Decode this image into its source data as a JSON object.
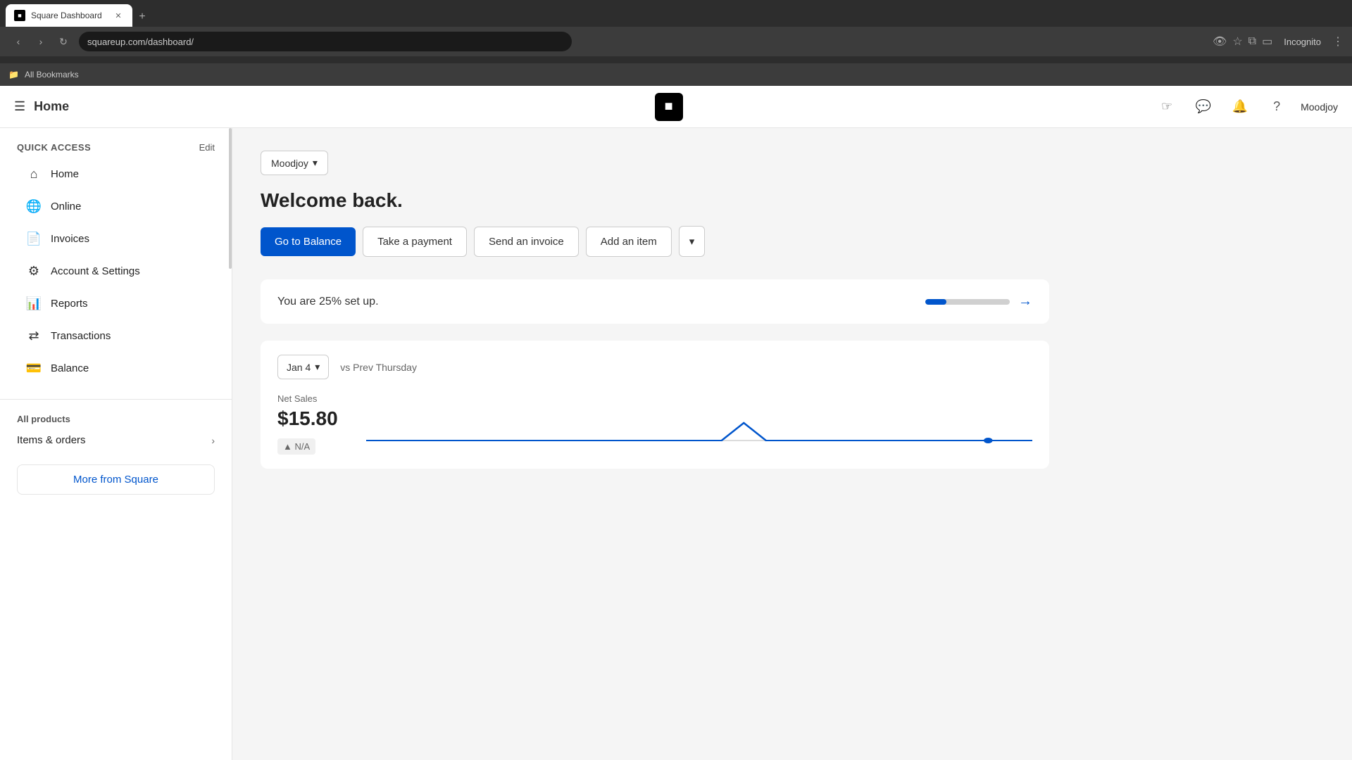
{
  "browser": {
    "url": "squareup.com/dashboard/",
    "tab_title": "Square Dashboard",
    "tab_new_label": "+",
    "bookmarks_label": "All Bookmarks",
    "profile_label": "Incognito"
  },
  "topbar": {
    "menu_icon": "☰",
    "title": "Home",
    "user_name": "Moodjoy"
  },
  "sidebar": {
    "quick_access_label": "Quick access",
    "edit_label": "Edit",
    "nav_items": [
      {
        "icon": "⌂",
        "label": "Home"
      },
      {
        "icon": "🌐",
        "label": "Online"
      },
      {
        "icon": "📄",
        "label": "Invoices"
      },
      {
        "icon": "⚙",
        "label": "Account & Settings"
      },
      {
        "icon": "📊",
        "label": "Reports"
      },
      {
        "icon": "⇄",
        "label": "Transactions"
      },
      {
        "icon": "💳",
        "label": "Balance"
      }
    ],
    "all_products_label": "All products",
    "products_items": [
      {
        "label": "Items & orders"
      }
    ],
    "more_from_square_label": "More from Square"
  },
  "main": {
    "business_name": "Moodjoy",
    "welcome_text": "Welcome back.",
    "buttons": {
      "go_to_balance": "Go to Balance",
      "take_payment": "Take a payment",
      "send_invoice": "Send an invoice",
      "add_item": "Add an item"
    },
    "setup": {
      "text": "You are 25% set up.",
      "progress": 25
    },
    "sales": {
      "date_label": "Jan 4",
      "compare_label": "vs Prev Thursday",
      "net_sales_label": "Net Sales",
      "net_sales_value": "$15.80",
      "na_label": "▲ N/A"
    }
  }
}
